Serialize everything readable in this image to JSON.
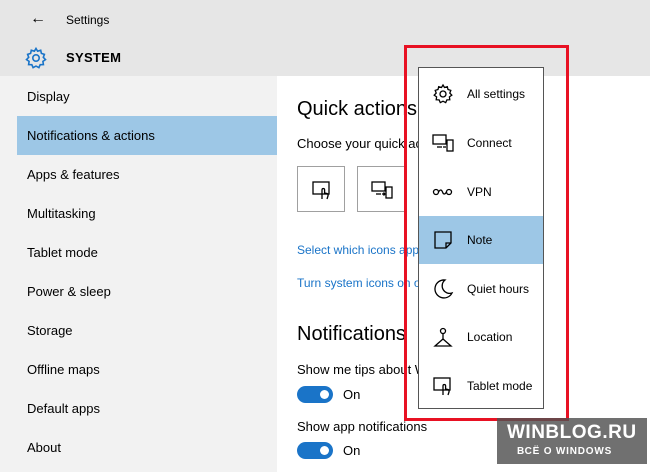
{
  "window": {
    "title": "Settings",
    "back_glyph": "←"
  },
  "header": {
    "section": "SYSTEM",
    "icon": "gear-icon"
  },
  "sidebar": {
    "items": [
      {
        "label": "Display"
      },
      {
        "label": "Notifications & actions",
        "selected": true
      },
      {
        "label": "Apps & features"
      },
      {
        "label": "Multitasking"
      },
      {
        "label": "Tablet mode"
      },
      {
        "label": "Power & sleep"
      },
      {
        "label": "Storage"
      },
      {
        "label": "Offline maps"
      },
      {
        "label": "Default apps"
      },
      {
        "label": "About"
      }
    ]
  },
  "main": {
    "quick_actions_heading": "Quick actions",
    "quick_actions_desc": "Choose your quick acti",
    "tiles": [
      {
        "icon": "tablet-mode-icon"
      },
      {
        "icon": "connect-icon"
      }
    ],
    "link_select_icons": "Select which icons app",
    "link_system_icons": "Turn system icons on o",
    "notifications_heading": "Notifications",
    "tips_label": "Show me tips about W",
    "tips_toggle": "On",
    "app_notifications_label": "Show app notifications",
    "app_notifications_toggle": "On"
  },
  "flyout": {
    "items": [
      {
        "label": "All settings",
        "icon": "gear-icon"
      },
      {
        "label": "Connect",
        "icon": "connect-icon"
      },
      {
        "label": "VPN",
        "icon": "vpn-icon"
      },
      {
        "label": "Note",
        "icon": "note-icon",
        "selected": true
      },
      {
        "label": "Quiet hours",
        "icon": "moon-icon"
      },
      {
        "label": "Location",
        "icon": "location-icon"
      },
      {
        "label": "Tablet mode",
        "icon": "tablet-mode-icon"
      }
    ]
  },
  "colors": {
    "accent": "#1a74c8",
    "selected": "#9dc7e6",
    "highlight_frame": "#e81123"
  },
  "watermark": {
    "line1": "WINBLOG.RU",
    "line2": "ВСЁ О WINDOWS"
  }
}
